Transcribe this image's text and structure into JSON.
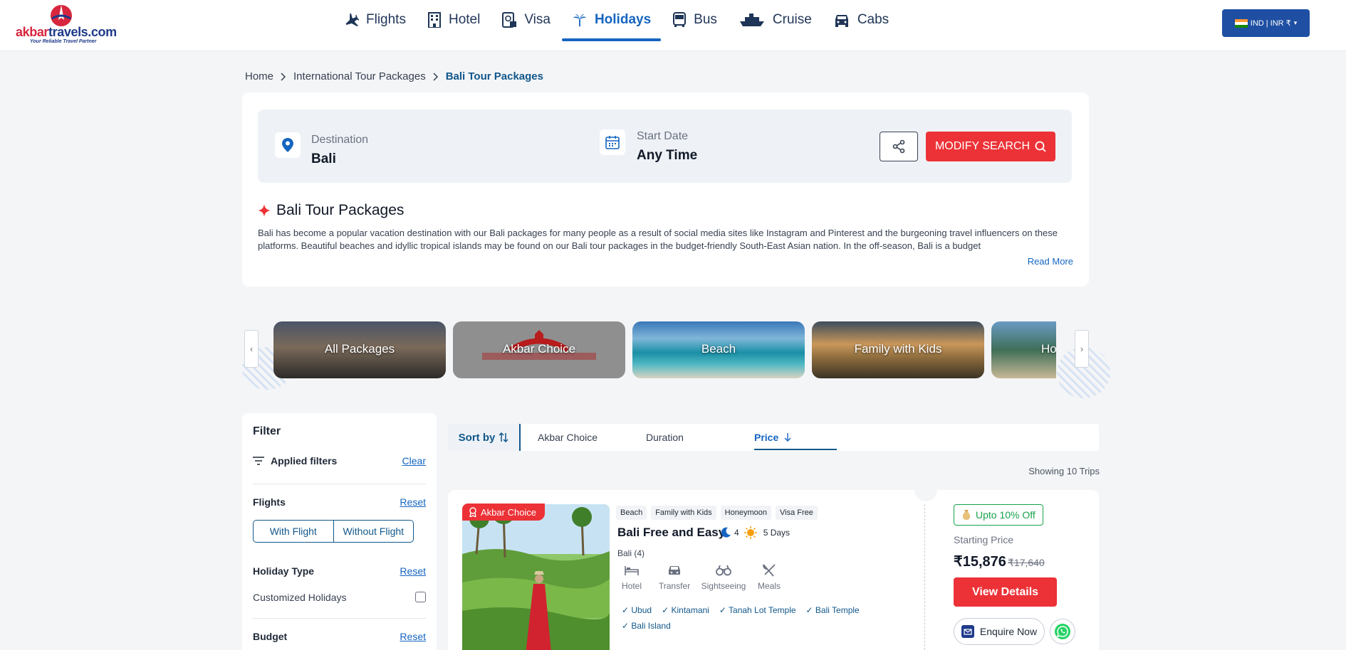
{
  "brand": {
    "logo_part1": "akbar",
    "logo_part2": "travels.com",
    "tagline": "Your Reliable Travel Partner"
  },
  "nav": [
    {
      "label": "Flights",
      "icon": "plane-icon",
      "active": false
    },
    {
      "label": "Hotel",
      "icon": "building-icon",
      "active": false
    },
    {
      "label": "Visa",
      "icon": "passport-icon",
      "active": false
    },
    {
      "label": "Holidays",
      "icon": "palm-tree-icon",
      "active": true
    },
    {
      "label": "Bus",
      "icon": "bus-icon",
      "active": false
    },
    {
      "label": "Cruise",
      "icon": "ship-icon",
      "active": false
    },
    {
      "label": "Cabs",
      "icon": "car-icon",
      "active": false
    }
  ],
  "currency": "IND | INR ₹",
  "breadcrumb": [
    "Home",
    "International Tour Packages",
    "Bali Tour Packages"
  ],
  "search": {
    "destination_label": "Destination",
    "destination_value": "Bali",
    "start_date_label": "Start Date",
    "start_date_value": "Any Time",
    "modify_label": "MODIFY SEARCH"
  },
  "intro": {
    "title": "Bali Tour Packages",
    "text": "Bali has become a popular vacation destination with our Bali packages for many people as a result of social media sites like Instagram and Pinterest and the burgeoning travel influencers on these platforms. Beautiful beaches and idyllic tropical islands may be found on our Bali tour packages in the budget-friendly South-East Asian nation. In the off-season, Bali is a budget",
    "read_more": "Read More"
  },
  "categories": [
    "All Packages",
    "Akbar Choice",
    "Beach",
    "Family with Kids",
    "Honeymoon"
  ],
  "filter": {
    "title": "Filter",
    "applied": "Applied filters",
    "clear": "Clear",
    "flights_title": "Flights",
    "reset": "Reset",
    "with_flight": "With Flight",
    "without_flight": "Without Flight",
    "holiday_type_title": "Holiday Type",
    "customized": "Customized Holidays",
    "budget_title": "Budget"
  },
  "sort": {
    "label": "Sort by",
    "options": [
      "Akbar Choice",
      "Duration",
      "Price"
    ],
    "active": "Price"
  },
  "showing": "Showing 10 Trips",
  "packages": [
    {
      "badge": "Akbar Choice",
      "tags": [
        "Beach",
        "Family with Kids",
        "Honeymoon",
        "Visa Free"
      ],
      "title": "Bali Free and Easy",
      "nights": "4",
      "days": "5 Days",
      "destinations": "Bali (4)",
      "amenities": [
        "Hotel",
        "Transfer",
        "Sightseeing",
        "Meals"
      ],
      "places": [
        "Ubud",
        "Kintamani",
        "Tanah Lot Temple",
        "Bali Temple",
        "Bali Island"
      ],
      "discount": "Upto 10% Off",
      "price_label": "Starting Price",
      "price": "₹15,876",
      "old_price": "₹17,640",
      "view_label": "View Details",
      "enquire_label": "Enquire Now"
    }
  ],
  "colors": {
    "brand_red": "#ec3237",
    "brand_blue": "#1565c0",
    "dark_blue": "#12578a",
    "offer_green": "#16a34a"
  }
}
